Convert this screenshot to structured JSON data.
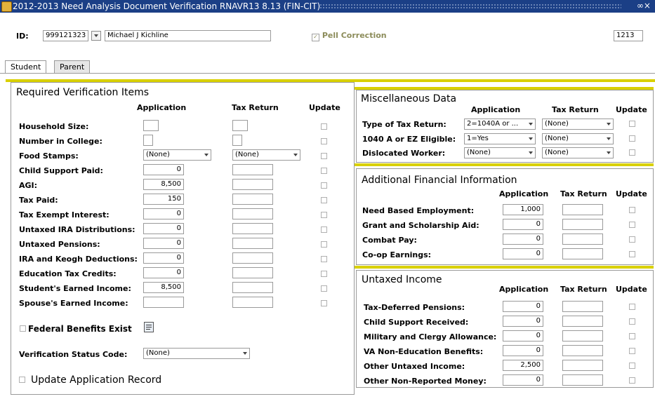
{
  "window": {
    "title": "2012-2013 Need Analysis Document Verification  RNAVR13  8.13  (FIN-CIT)"
  },
  "header": {
    "id_label": "ID:",
    "id_value": "999121323",
    "name_value": "Michael J Kichline",
    "pell_label": "Pell Correction",
    "right_field_value": "1213"
  },
  "tabs": [
    "Student",
    "Parent"
  ],
  "verification": {
    "title": "Required Verification Items",
    "col_application": "Application",
    "col_tax_return": "Tax Return",
    "col_update": "Update",
    "rows": [
      {
        "label": "Household Size:",
        "app": "",
        "tax": ""
      },
      {
        "label": "Number in College:",
        "app": "",
        "tax": ""
      },
      {
        "label": "Food Stamps:",
        "app": "(None)",
        "tax": "(None)"
      },
      {
        "label": "Child Support Paid:",
        "app": "0",
        "tax": ""
      },
      {
        "label": "AGI:",
        "app": "8,500",
        "tax": ""
      },
      {
        "label": "Tax Paid:",
        "app": "150",
        "tax": ""
      },
      {
        "label": "Tax Exempt Interest:",
        "app": "0",
        "tax": ""
      },
      {
        "label": "Untaxed IRA Distributions:",
        "app": "0",
        "tax": ""
      },
      {
        "label": "Untaxed Pensions:",
        "app": "0",
        "tax": ""
      },
      {
        "label": "IRA and Keogh Deductions:",
        "app": "0",
        "tax": ""
      },
      {
        "label": "Education Tax Credits:",
        "app": "0",
        "tax": ""
      },
      {
        "label": "Student's Earned Income:",
        "app": "8,500",
        "tax": ""
      },
      {
        "label": "Spouse's Earned Income:",
        "app": "",
        "tax": ""
      }
    ],
    "federal_benefits_label": "Federal Benefits Exist",
    "status_code_label": "Verification Status Code:",
    "status_code_value": "(None)",
    "update_app_label": "Update Application Record"
  },
  "misc": {
    "title": "Miscellaneous Data",
    "col_application": "Application",
    "col_tax_return": "Tax Return",
    "col_update": "Update",
    "rows": [
      {
        "label": "Type of Tax Return:",
        "app": "2=1040A or ...",
        "tax": "(None)"
      },
      {
        "label": "1040 A or EZ Eligible:",
        "app": "1=Yes",
        "tax": "(None)"
      },
      {
        "label": "Dislocated Worker:",
        "app": "(None)",
        "tax": "(None)"
      }
    ]
  },
  "additional": {
    "title": "Additional Financial Information",
    "col_application": "Application",
    "col_tax_return": "Tax Return",
    "col_update": "Update",
    "rows": [
      {
        "label": "Need Based Employment:",
        "app": "1,000"
      },
      {
        "label": "Grant and Scholarship Aid:",
        "app": "0"
      },
      {
        "label": "Combat Pay:",
        "app": "0"
      },
      {
        "label": "Co-op Earnings:",
        "app": "0"
      }
    ]
  },
  "untaxed": {
    "title": "Untaxed Income",
    "col_application": "Application",
    "col_tax_return": "Tax Return",
    "col_update": "Update",
    "rows": [
      {
        "label": "Tax-Deferred Pensions:",
        "app": "0"
      },
      {
        "label": "Child Support Received:",
        "app": "0"
      },
      {
        "label": "Military and Clergy Allowance:",
        "app": "0"
      },
      {
        "label": "VA Non-Education Benefits:",
        "app": "0"
      },
      {
        "label": "Other Untaxed Income:",
        "app": "2,500"
      },
      {
        "label": "Other Non-Reported Money:",
        "app": "0"
      }
    ]
  },
  "colors": {
    "titlebar": "#1b3f86",
    "accent_bar": "#d9d000",
    "pell_text": "#8c8c5a"
  }
}
